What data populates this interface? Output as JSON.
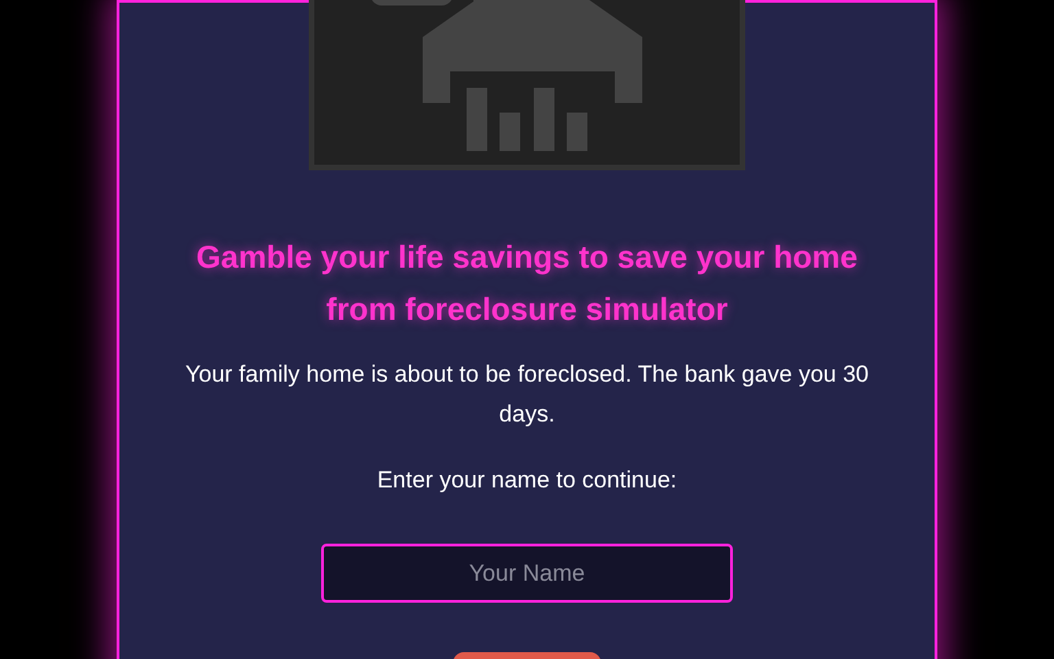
{
  "dialog": {
    "title": "Gamble your life savings to save your home from foreclosure simulator",
    "description": "Your family home is about to be foreclosed. The bank gave you 30 days.",
    "prompt": "Enter your name to continue:",
    "name_field": {
      "placeholder": "Your Name"
    }
  }
}
